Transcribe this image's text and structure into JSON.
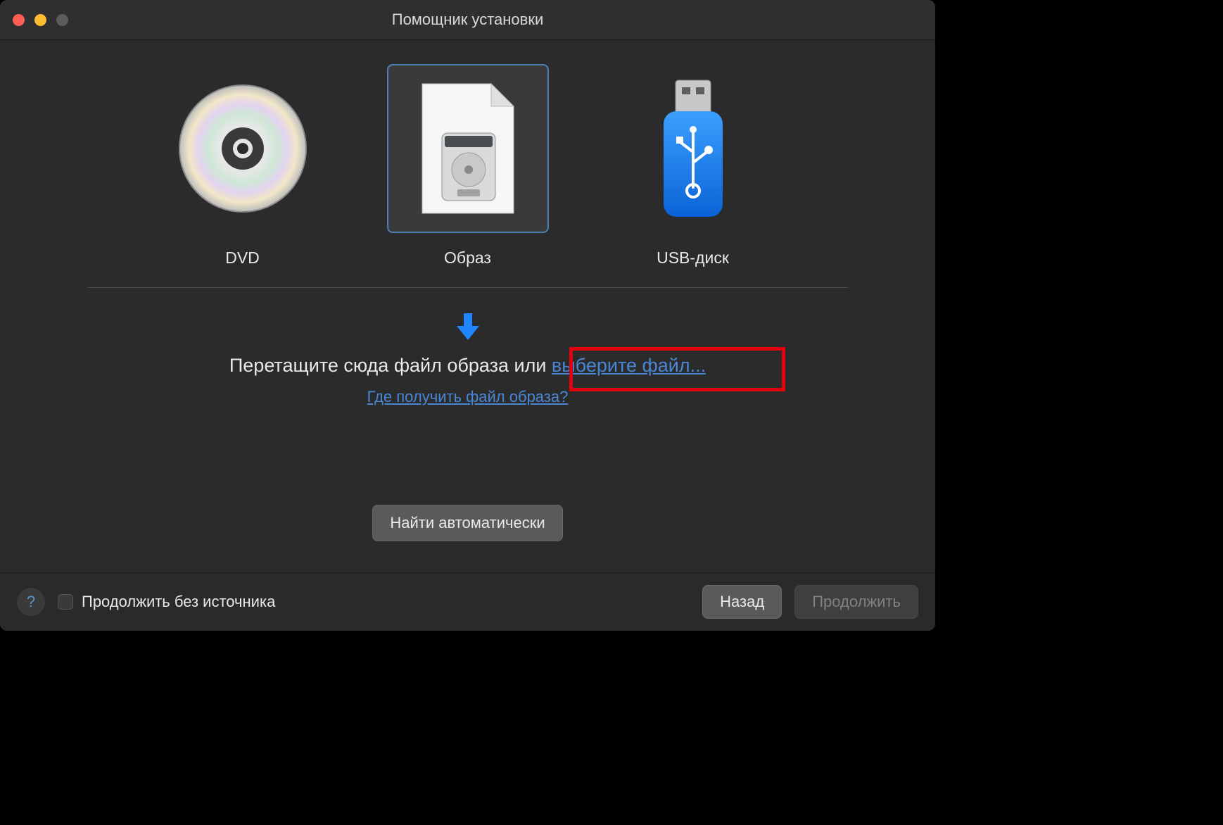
{
  "window": {
    "title": "Помощник установки"
  },
  "options": {
    "dvd": {
      "label": "DVD"
    },
    "image": {
      "label": "Образ",
      "selected": true
    },
    "usb": {
      "label": "USB-диск"
    }
  },
  "drop": {
    "text_prefix": "Перетащите сюда файл образа или ",
    "choose_link": "выберите файл...",
    "help_link": "Где получить файл образа?"
  },
  "buttons": {
    "auto": "Найти автоматически",
    "back": "Назад",
    "continue": "Продолжить"
  },
  "footer": {
    "no_source_label": "Продолжить без источника",
    "continue_enabled": false
  },
  "colors": {
    "link": "#4a86d6",
    "accent": "#4d7fb3",
    "highlight": "#e3000f"
  }
}
